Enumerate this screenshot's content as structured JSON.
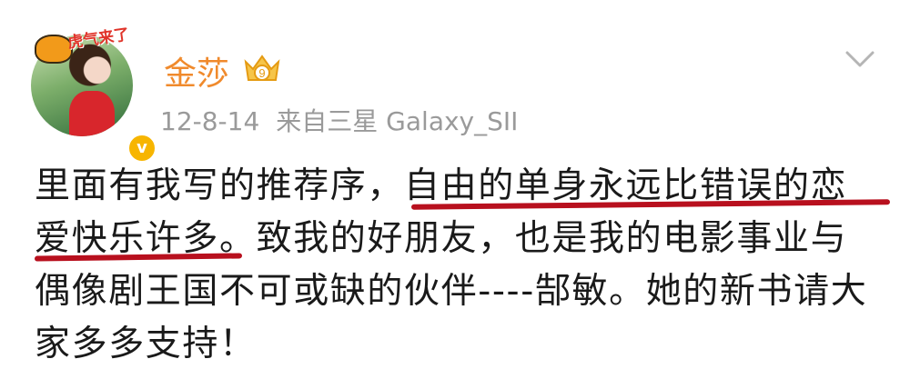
{
  "post": {
    "avatar_badge": "虎气来了",
    "username": "金莎",
    "vip_level": "9",
    "date": "12-8-14",
    "source": "来自三星 Galaxy_SII",
    "text": "里面有我写的推荐序，自由的单身永远比错误的恋爱快乐许多。致我的好朋友，也是我的电影事业与偶像剧王国不可或缺的伙伴----郜敏。她的新书请大家多多支持！"
  },
  "colors": {
    "username": "#f08a2c",
    "meta": "#9a9a9a",
    "underline": "#b8101e",
    "verified": "#f7b500"
  }
}
